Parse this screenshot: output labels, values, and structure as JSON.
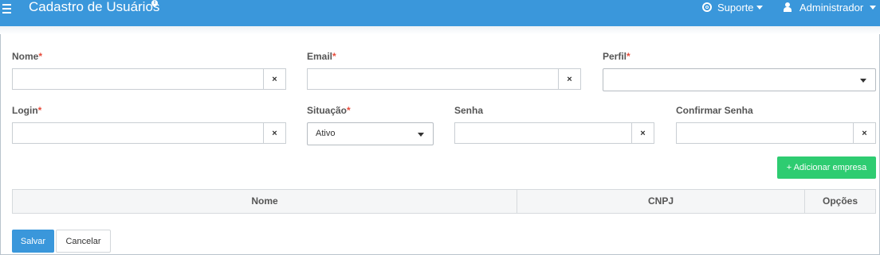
{
  "header": {
    "title": "Cadastro de Usuários",
    "title_badge": "i",
    "support_label": "Suporte",
    "admin_label": "Administrador"
  },
  "form": {
    "nome_label": "Nome",
    "email_label": "Email",
    "perfil_label": "Perfil",
    "login_label": "Login",
    "situacao_label": "Situação",
    "senha_label": "Senha",
    "confirmar_senha_label": "Confirmar Senha",
    "required_mark": "*",
    "nome_value": "",
    "email_value": "",
    "perfil_value": "",
    "login_value": "",
    "situacao_value": "Ativo",
    "senha_value": "",
    "confirmar_senha_value": "",
    "clear_glyph": "×"
  },
  "empresas": {
    "add_button_label": "+ Adicionar empresa",
    "columns": [
      "Nome",
      "CNPJ",
      "Opções"
    ]
  },
  "actions": {
    "save_label": "Salvar",
    "cancel_label": "Cancelar"
  },
  "colors": {
    "header_bg": "#3a97db",
    "success": "#2ecc71",
    "primary": "#3a97db",
    "required": "#e74c3c"
  }
}
